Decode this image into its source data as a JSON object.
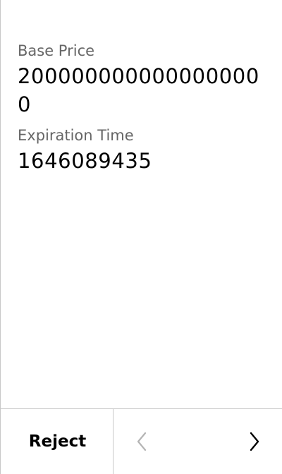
{
  "fields": [
    {
      "label": "Base Price",
      "value": "2000000000000000000"
    },
    {
      "label": "Expiration Time",
      "value": "1646089435"
    }
  ],
  "footer": {
    "reject_label": "Reject",
    "prev_icon": "chevron-left-icon",
    "next_icon": "chevron-right-icon",
    "prev_enabled": false,
    "next_enabled": true
  },
  "colors": {
    "label": "#666666",
    "value": "#000000",
    "border": "#c8c8c8",
    "icon_disabled": "#b4b4b4",
    "icon_enabled": "#000000"
  }
}
